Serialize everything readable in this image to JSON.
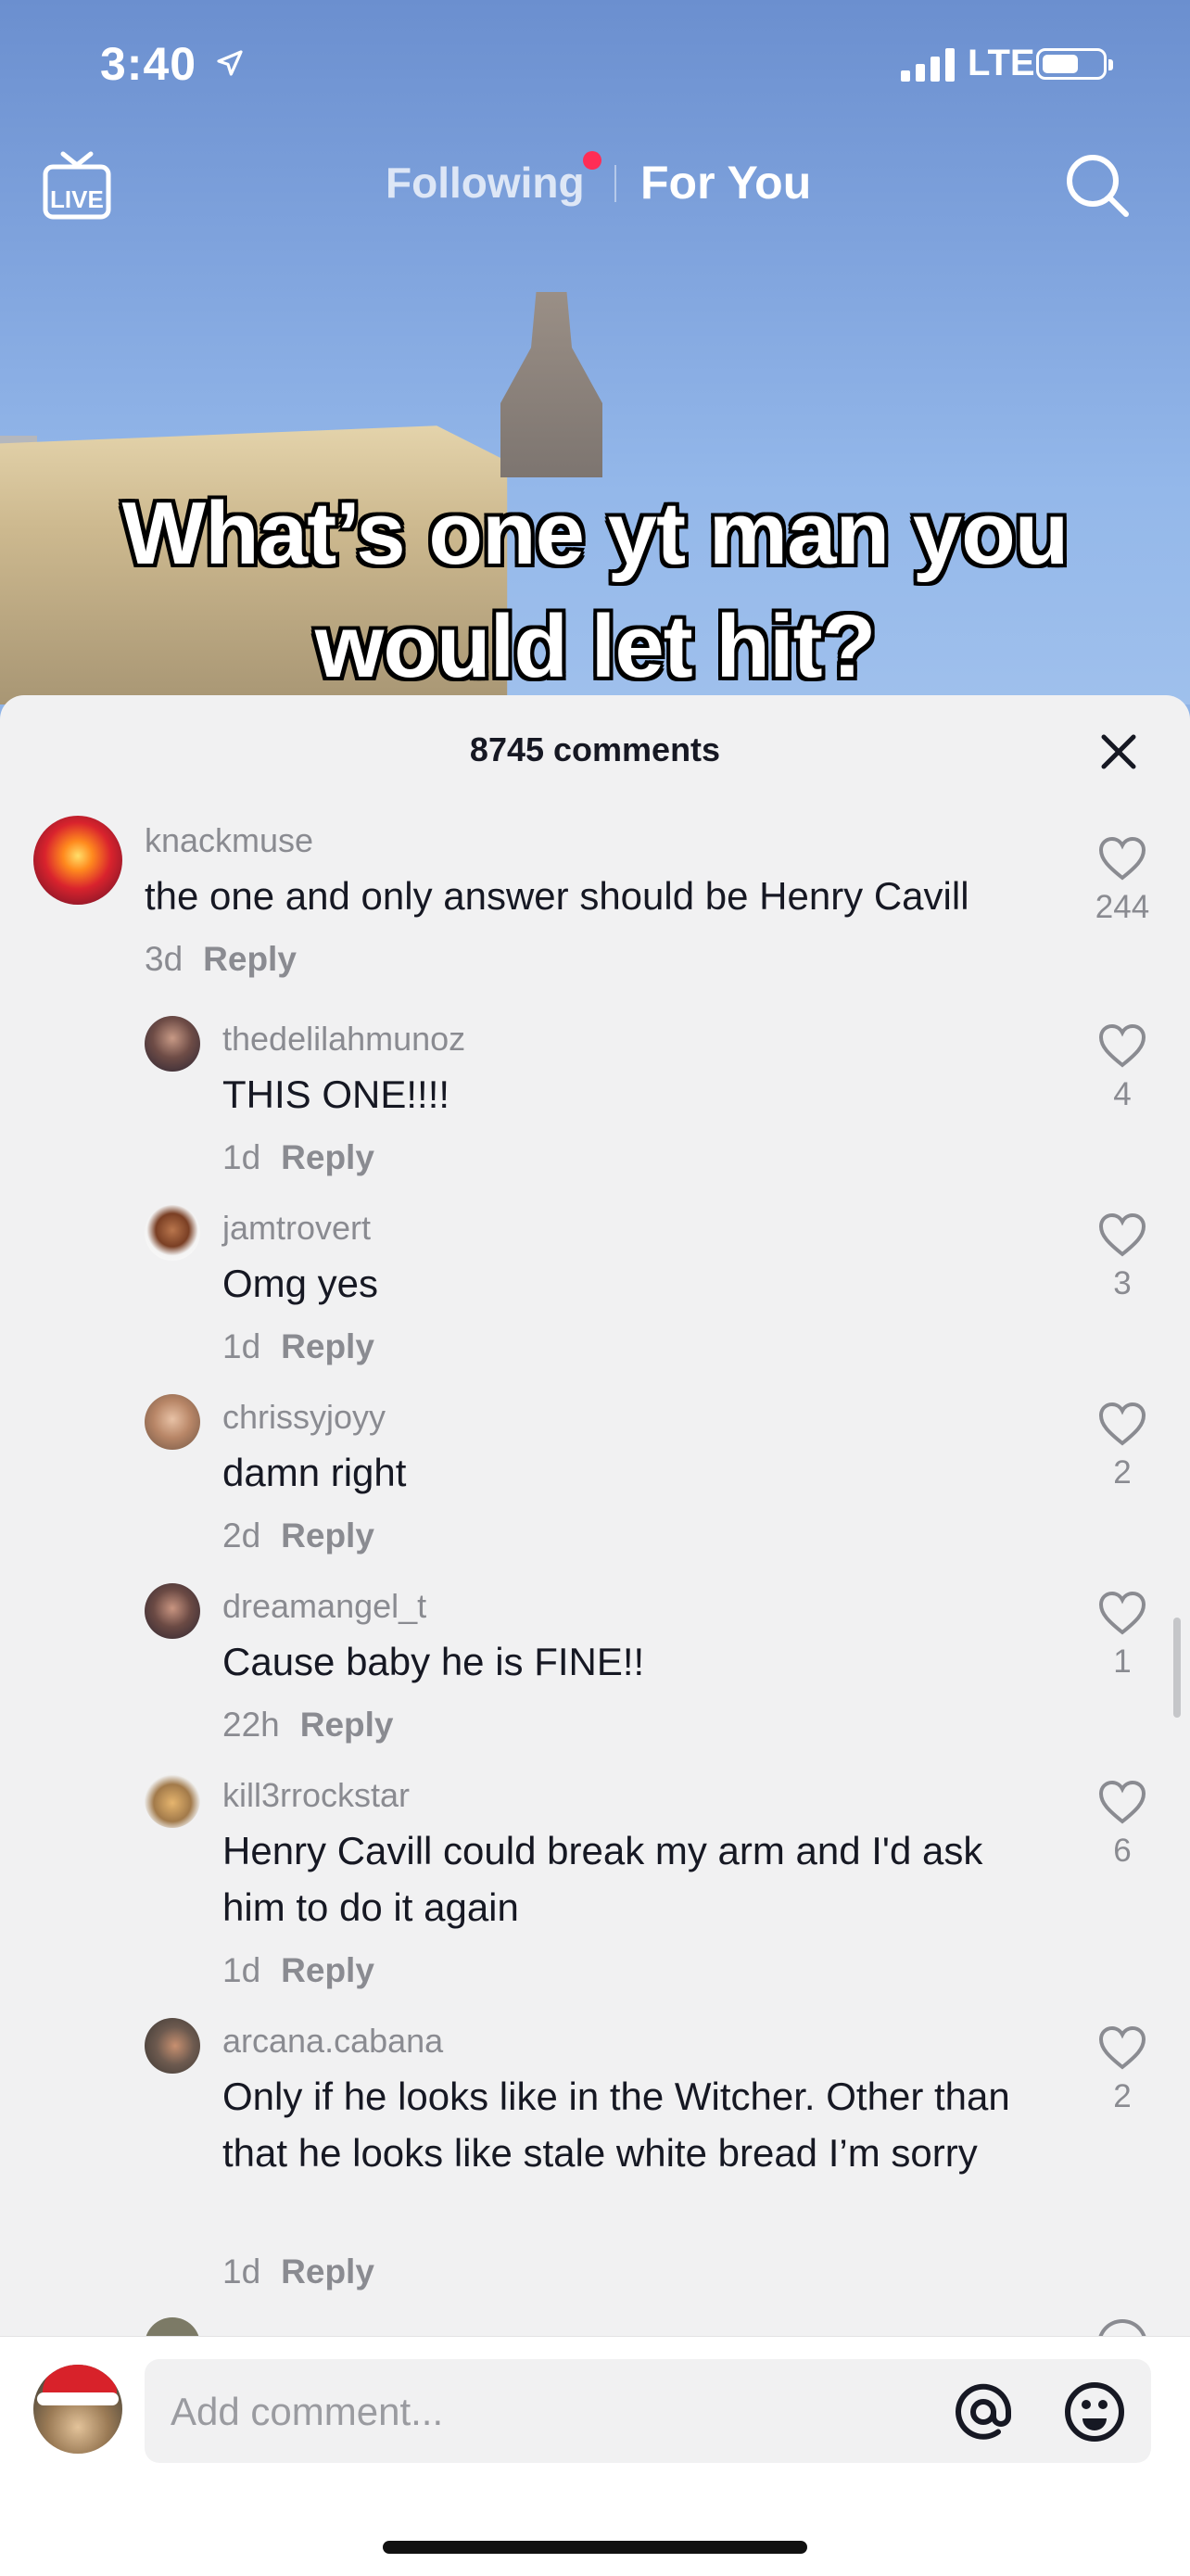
{
  "status_bar": {
    "time": "3:40",
    "network": "LTE"
  },
  "nav": {
    "following": "Following",
    "for_you": "For You",
    "live_label": "LIVE"
  },
  "video": {
    "caption_line1": "What’s one yt man you",
    "caption_line2": "would let hit?"
  },
  "comments_panel": {
    "title": "8745 comments",
    "reply_label": "Reply",
    "comments": [
      {
        "user": "knackmuse",
        "text": "the one and only answer should be Henry Cavill",
        "age": "3d",
        "likes": "244"
      },
      {
        "user": "thedelilahmunoz",
        "text": "THIS ONE!!!!",
        "age": "1d",
        "likes": "4"
      },
      {
        "user": "jamtrovert",
        "text": "Omg yes",
        "age": "1d",
        "likes": "3"
      },
      {
        "user": "chrissyjoyy",
        "text": "damn right",
        "age": "2d",
        "likes": "2"
      },
      {
        "user": "dreamangel_t",
        "text": "Cause baby he is FINE!!",
        "age": "22h",
        "likes": "1"
      },
      {
        "user": "kill3rrockstar",
        "text": "Henry Cavill could break my arm and I'd ask him to do it again",
        "age": "1d",
        "likes": "6"
      },
      {
        "user": "arcana.cabana",
        "text": "Only if he looks like in the Witcher. Other than that he looks like stale white bread I’m sorry",
        "age": "1d",
        "likes": "2"
      }
    ]
  },
  "composer": {
    "placeholder": "Add comment..."
  },
  "colors": {
    "accent_dot": "#ff2d55",
    "sheet_bg": "#f1f1f2",
    "text_primary": "#161823",
    "text_secondary": "#8a8b91"
  }
}
